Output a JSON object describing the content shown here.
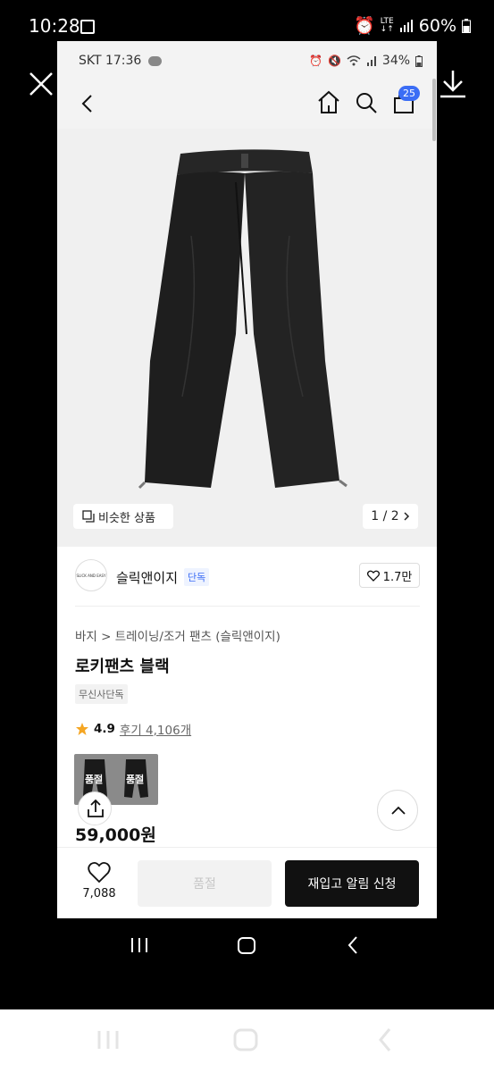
{
  "outer_status": {
    "time": "10:28",
    "network": "LTE",
    "battery": "60%"
  },
  "inner_status": {
    "carrier_time": "SKT 17:36",
    "battery": "34%"
  },
  "nav": {
    "cart_count": "25"
  },
  "gallery": {
    "similar_label": "비슷한 상품",
    "pager": "1 / 2"
  },
  "brand": {
    "logo_text": "SLICK AND EASY",
    "name": "슬릭앤이지",
    "badge": "단독",
    "likes": "1.7만"
  },
  "product": {
    "breadcrumb": "바지 > 트레이닝/조거 팬츠 (슬릭앤이지)",
    "title": "로키팬츠 블랙",
    "tag": "무신사단독",
    "rating": "4.9",
    "reviews": "후기 4,106개",
    "thumb_soldout_1": "품절",
    "thumb_soldout_2": "품절",
    "price": "59,000원"
  },
  "bottom_bar": {
    "wish_count": "7,088",
    "soldout_label": "품절",
    "restock_label": "재입고 알림 신청"
  },
  "colors": {
    "accent_blue": "#3b6df5",
    "restock_bg": "#111111",
    "star": "#f5a623"
  }
}
